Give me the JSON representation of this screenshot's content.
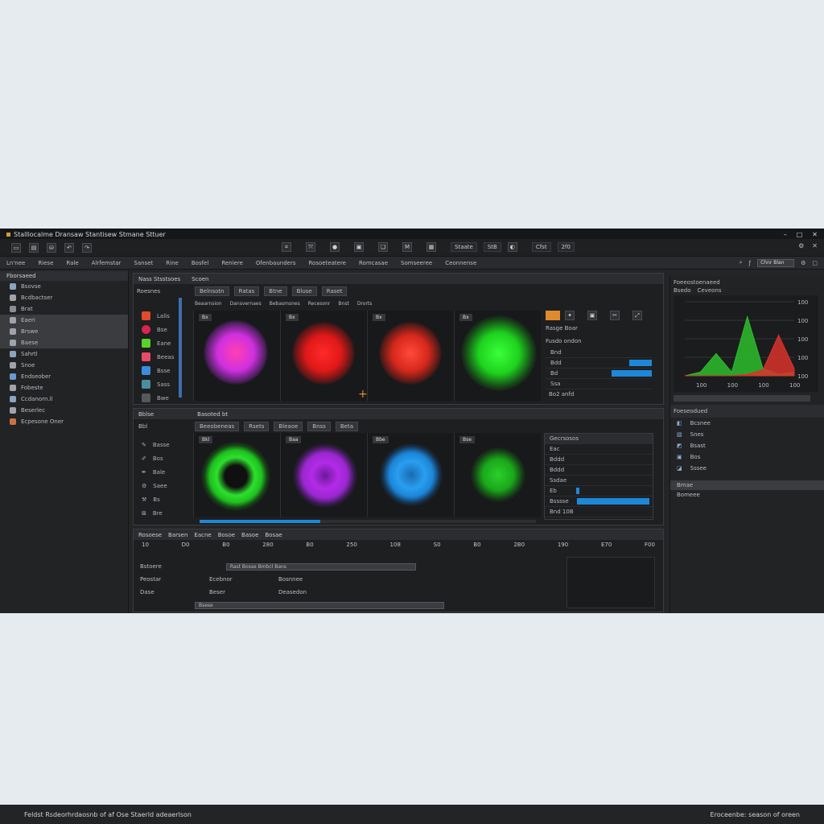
{
  "window": {
    "title": "Stalllocalme Dransaw Stantisew Stmane Sttuer"
  },
  "toolbar": {
    "center_labels": [
      "Staate",
      "StB"
    ],
    "right_labels": [
      "Cfst",
      "2f0"
    ]
  },
  "menubar": {
    "items": [
      "Ln'nee",
      "Riese",
      "Rale",
      "Alrfemstar",
      "Sanset",
      "Rine",
      "Bosfel",
      "Reniere",
      "Ofenbaunders",
      "Rosoeteatere",
      "Romcasae",
      "Somseeree",
      "Ceonnense"
    ],
    "field_value": "Chnr Blan"
  },
  "left_panel": {
    "header": "Fborsaeed",
    "items": [
      {
        "label": "Bsovse",
        "icon": "brush-icon",
        "selected": false
      },
      {
        "label": "Bcdbactser",
        "icon": "cloud-icon",
        "selected": false
      },
      {
        "label": "Brat",
        "icon": "layers-icon",
        "selected": false
      },
      {
        "label": "Eaeri",
        "icon": "square-icon",
        "selected": true
      },
      {
        "label": "Brswe",
        "icon": "circle-icon",
        "selected": true
      },
      {
        "label": "Baese",
        "icon": "circle-icon",
        "selected": true
      },
      {
        "label": "Sahrtl",
        "icon": "pen-icon",
        "selected": false
      },
      {
        "label": "Snoe",
        "icon": "drop-icon",
        "selected": false
      },
      {
        "label": "Endseober",
        "icon": "eye-icon",
        "selected": false
      },
      {
        "label": "Fobeste",
        "icon": "eye-icon",
        "selected": false
      },
      {
        "label": "Ccdanorn.ll",
        "icon": "pencil-icon",
        "selected": false
      },
      {
        "label": "Beserlec",
        "icon": "pencil-icon",
        "selected": false
      },
      {
        "label": "Ecpesone Oner",
        "icon": "flame-icon",
        "selected": false
      }
    ]
  },
  "top_panel": {
    "title": "Nass Stsstsoes",
    "subtitle": "Scoen",
    "side_header": "Roesnes",
    "tabs": [
      "Belnsotn",
      "Ratas",
      "Btne",
      "Bluse",
      "Raset"
    ],
    "subtabs": [
      "Beaarnsion",
      "Dansvernaes",
      "Bebasmsnes",
      "Recesonr",
      "Bnst",
      "Drorts"
    ],
    "tools": [
      {
        "label": "Lalis",
        "color": "#e14a2c"
      },
      {
        "label": "Bse",
        "color": "#d8254f"
      },
      {
        "label": "Eane",
        "color": "#58d12b"
      },
      {
        "label": "Beeas",
        "color": "#e64c6a"
      },
      {
        "label": "Bsse",
        "color": "#3a8de0"
      },
      {
        "label": "Sass",
        "color": "#4a8fa0"
      },
      {
        "label": "Bwe",
        "color": "#55585c"
      }
    ],
    "viewers": [
      "Bx",
      "Bx",
      "Bx",
      "Bx"
    ],
    "props": {
      "header": "Rasge Boar",
      "sub": "Fusdo ondon",
      "rows": [
        "Bnd",
        "Bdd",
        "Bd",
        "Ssa"
      ],
      "footer": "Bo2 anfd"
    }
  },
  "mid_panel": {
    "title": "Bblse",
    "subtitle": "Basoted bt",
    "side_header": "Bbl",
    "tabs": [
      "Beeobeneas",
      "Rsets",
      "Bleaoe",
      "Bnss",
      "Beta"
    ],
    "tools": [
      "Basse",
      "Bos",
      "Bale",
      "Saee",
      "Bs",
      "Bre"
    ],
    "viewers": [
      "Bkl",
      "Baa",
      "Bbe",
      "Bse"
    ],
    "props": {
      "header": "Gecrsosos",
      "rows": [
        "Eac",
        "Bddd",
        "Bddd",
        "Ssdae",
        "Eb",
        "Bsssse"
      ],
      "footer": "Bnd 10B"
    },
    "progress": 0.36
  },
  "timeline": {
    "tabs": [
      "Rosoese",
      "Barsen",
      "Eacne",
      "Bosoe",
      "Basoe",
      "Bosae"
    ],
    "ruler": [
      "10",
      "D0",
      "B0",
      "280",
      "B0",
      "250",
      "108",
      "S0",
      "B0",
      "2B0",
      "190",
      "E70",
      "F00"
    ],
    "rows": [
      {
        "a": "Bstoere",
        "b": "",
        "c": ""
      },
      {
        "a": "Peostar",
        "b": "Ecebnor",
        "c": "Bosnnee"
      },
      {
        "a": "Dase",
        "b": "Beser",
        "c": "Deasedon"
      }
    ],
    "field": "Rast Bosse Bmbcl Bans",
    "bottom_field": "Bsese"
  },
  "right_panel": {
    "header": "Foeeostoenaeed",
    "sub_a": "Bsedo",
    "sub_b": "Ceveons",
    "y_ticks": [
      "100",
      "100",
      "100",
      "100",
      "100"
    ],
    "x_ticks": [
      "100",
      "100",
      "100",
      "100"
    ],
    "chart_data": {
      "type": "area",
      "series": [
        {
          "values": [
            0,
            5,
            30,
            5,
            80,
            10,
            2,
            5
          ]
        },
        {
          "values": [
            0,
            0,
            0,
            0,
            2,
            8,
            55,
            10
          ]
        }
      ],
      "colors": [
        "#2bbd2b",
        "#d8322c"
      ]
    },
    "list_header": "Foeseodued",
    "items": [
      "Bcsnee",
      "Snes",
      "Bsast",
      "Bos",
      "Sssee"
    ],
    "footer_items": [
      "Bmae",
      "Bomeee"
    ]
  },
  "statusbar": {
    "left": "Feldst Rsdeorhrdaosnb of af Ose Staerld adeaerlson",
    "right": "Eroceenbe: season of oreen"
  }
}
